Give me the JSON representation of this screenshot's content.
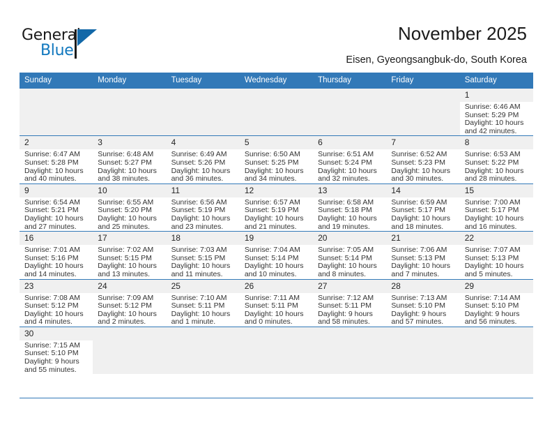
{
  "brand": {
    "name_part1": "General",
    "name_part2": "Blue",
    "triangle_color": "#1268a8",
    "blue_text_color": "#1278be"
  },
  "header": {
    "title": "November 2025",
    "subtitle": "Eisen, Gyeongsangbuk-do, South Korea"
  },
  "theme": {
    "header_row_bg": "#3279b8",
    "daynum_bg": "#f0f0f0",
    "grid_line": "#3279b8"
  },
  "weekdays": [
    "Sunday",
    "Monday",
    "Tuesday",
    "Wednesday",
    "Thursday",
    "Friday",
    "Saturday"
  ],
  "labels": {
    "sunrise": "Sunrise:",
    "sunset": "Sunset:",
    "daylight": "Daylight:"
  },
  "weeks": [
    [
      {
        "blank": true
      },
      {
        "blank": true
      },
      {
        "blank": true
      },
      {
        "blank": true
      },
      {
        "blank": true
      },
      {
        "blank": true
      },
      {
        "day": "1",
        "sunrise": "Sunrise: 6:46 AM",
        "sunset": "Sunset: 5:29 PM",
        "daylight1": "Daylight: 10 hours",
        "daylight2": "and 42 minutes."
      }
    ],
    [
      {
        "day": "2",
        "sunrise": "Sunrise: 6:47 AM",
        "sunset": "Sunset: 5:28 PM",
        "daylight1": "Daylight: 10 hours",
        "daylight2": "and 40 minutes."
      },
      {
        "day": "3",
        "sunrise": "Sunrise: 6:48 AM",
        "sunset": "Sunset: 5:27 PM",
        "daylight1": "Daylight: 10 hours",
        "daylight2": "and 38 minutes."
      },
      {
        "day": "4",
        "sunrise": "Sunrise: 6:49 AM",
        "sunset": "Sunset: 5:26 PM",
        "daylight1": "Daylight: 10 hours",
        "daylight2": "and 36 minutes."
      },
      {
        "day": "5",
        "sunrise": "Sunrise: 6:50 AM",
        "sunset": "Sunset: 5:25 PM",
        "daylight1": "Daylight: 10 hours",
        "daylight2": "and 34 minutes."
      },
      {
        "day": "6",
        "sunrise": "Sunrise: 6:51 AM",
        "sunset": "Sunset: 5:24 PM",
        "daylight1": "Daylight: 10 hours",
        "daylight2": "and 32 minutes."
      },
      {
        "day": "7",
        "sunrise": "Sunrise: 6:52 AM",
        "sunset": "Sunset: 5:23 PM",
        "daylight1": "Daylight: 10 hours",
        "daylight2": "and 30 minutes."
      },
      {
        "day": "8",
        "sunrise": "Sunrise: 6:53 AM",
        "sunset": "Sunset: 5:22 PM",
        "daylight1": "Daylight: 10 hours",
        "daylight2": "and 28 minutes."
      }
    ],
    [
      {
        "day": "9",
        "sunrise": "Sunrise: 6:54 AM",
        "sunset": "Sunset: 5:21 PM",
        "daylight1": "Daylight: 10 hours",
        "daylight2": "and 27 minutes."
      },
      {
        "day": "10",
        "sunrise": "Sunrise: 6:55 AM",
        "sunset": "Sunset: 5:20 PM",
        "daylight1": "Daylight: 10 hours",
        "daylight2": "and 25 minutes."
      },
      {
        "day": "11",
        "sunrise": "Sunrise: 6:56 AM",
        "sunset": "Sunset: 5:19 PM",
        "daylight1": "Daylight: 10 hours",
        "daylight2": "and 23 minutes."
      },
      {
        "day": "12",
        "sunrise": "Sunrise: 6:57 AM",
        "sunset": "Sunset: 5:19 PM",
        "daylight1": "Daylight: 10 hours",
        "daylight2": "and 21 minutes."
      },
      {
        "day": "13",
        "sunrise": "Sunrise: 6:58 AM",
        "sunset": "Sunset: 5:18 PM",
        "daylight1": "Daylight: 10 hours",
        "daylight2": "and 19 minutes."
      },
      {
        "day": "14",
        "sunrise": "Sunrise: 6:59 AM",
        "sunset": "Sunset: 5:17 PM",
        "daylight1": "Daylight: 10 hours",
        "daylight2": "and 18 minutes."
      },
      {
        "day": "15",
        "sunrise": "Sunrise: 7:00 AM",
        "sunset": "Sunset: 5:17 PM",
        "daylight1": "Daylight: 10 hours",
        "daylight2": "and 16 minutes."
      }
    ],
    [
      {
        "day": "16",
        "sunrise": "Sunrise: 7:01 AM",
        "sunset": "Sunset: 5:16 PM",
        "daylight1": "Daylight: 10 hours",
        "daylight2": "and 14 minutes."
      },
      {
        "day": "17",
        "sunrise": "Sunrise: 7:02 AM",
        "sunset": "Sunset: 5:15 PM",
        "daylight1": "Daylight: 10 hours",
        "daylight2": "and 13 minutes."
      },
      {
        "day": "18",
        "sunrise": "Sunrise: 7:03 AM",
        "sunset": "Sunset: 5:15 PM",
        "daylight1": "Daylight: 10 hours",
        "daylight2": "and 11 minutes."
      },
      {
        "day": "19",
        "sunrise": "Sunrise: 7:04 AM",
        "sunset": "Sunset: 5:14 PM",
        "daylight1": "Daylight: 10 hours",
        "daylight2": "and 10 minutes."
      },
      {
        "day": "20",
        "sunrise": "Sunrise: 7:05 AM",
        "sunset": "Sunset: 5:14 PM",
        "daylight1": "Daylight: 10 hours",
        "daylight2": "and 8 minutes."
      },
      {
        "day": "21",
        "sunrise": "Sunrise: 7:06 AM",
        "sunset": "Sunset: 5:13 PM",
        "daylight1": "Daylight: 10 hours",
        "daylight2": "and 7 minutes."
      },
      {
        "day": "22",
        "sunrise": "Sunrise: 7:07 AM",
        "sunset": "Sunset: 5:13 PM",
        "daylight1": "Daylight: 10 hours",
        "daylight2": "and 5 minutes."
      }
    ],
    [
      {
        "day": "23",
        "sunrise": "Sunrise: 7:08 AM",
        "sunset": "Sunset: 5:12 PM",
        "daylight1": "Daylight: 10 hours",
        "daylight2": "and 4 minutes."
      },
      {
        "day": "24",
        "sunrise": "Sunrise: 7:09 AM",
        "sunset": "Sunset: 5:12 PM",
        "daylight1": "Daylight: 10 hours",
        "daylight2": "and 2 minutes."
      },
      {
        "day": "25",
        "sunrise": "Sunrise: 7:10 AM",
        "sunset": "Sunset: 5:11 PM",
        "daylight1": "Daylight: 10 hours",
        "daylight2": "and 1 minute."
      },
      {
        "day": "26",
        "sunrise": "Sunrise: 7:11 AM",
        "sunset": "Sunset: 5:11 PM",
        "daylight1": "Daylight: 10 hours",
        "daylight2": "and 0 minutes."
      },
      {
        "day": "27",
        "sunrise": "Sunrise: 7:12 AM",
        "sunset": "Sunset: 5:11 PM",
        "daylight1": "Daylight: 9 hours",
        "daylight2": "and 58 minutes."
      },
      {
        "day": "28",
        "sunrise": "Sunrise: 7:13 AM",
        "sunset": "Sunset: 5:10 PM",
        "daylight1": "Daylight: 9 hours",
        "daylight2": "and 57 minutes."
      },
      {
        "day": "29",
        "sunrise": "Sunrise: 7:14 AM",
        "sunset": "Sunset: 5:10 PM",
        "daylight1": "Daylight: 9 hours",
        "daylight2": "and 56 minutes."
      }
    ],
    [
      {
        "day": "30",
        "sunrise": "Sunrise: 7:15 AM",
        "sunset": "Sunset: 5:10 PM",
        "daylight1": "Daylight: 9 hours",
        "daylight2": "and 55 minutes."
      },
      {
        "blank": true
      },
      {
        "blank": true
      },
      {
        "blank": true
      },
      {
        "blank": true
      },
      {
        "blank": true
      },
      {
        "blank": true
      }
    ]
  ]
}
